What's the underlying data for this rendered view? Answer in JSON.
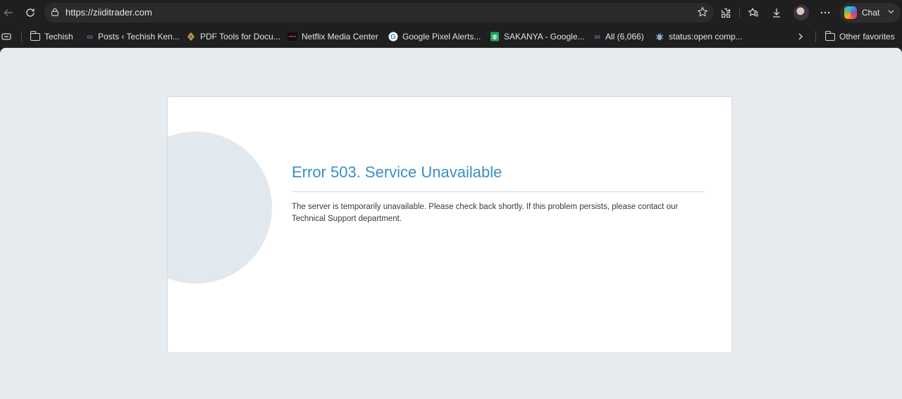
{
  "browser": {
    "url": "https://ziiditrader.com",
    "chat_label": "Chat",
    "icons": [
      "back-icon",
      "reload-icon",
      "lock-icon",
      "star-icon",
      "extensions-icon",
      "favorites-icon",
      "download-icon",
      "more-icon",
      "copilot-icon",
      "chevron-down-icon"
    ]
  },
  "bookmarks": [
    {
      "label": "Techish",
      "icon": "folder-icon"
    },
    {
      "label": "Posts ‹ Techish Ken...",
      "icon": "chain-icon"
    },
    {
      "label": "PDF Tools for Docu...",
      "icon": "pdf-tool-icon"
    },
    {
      "label": "Netflix Media Center",
      "icon": "netflix-icon"
    },
    {
      "label": "Google Pixel Alerts...",
      "icon": "google-icon"
    },
    {
      "label": "SAKANYA - Google...",
      "icon": "sheets-icon"
    },
    {
      "label": "All (6,066)",
      "icon": "chain-icon"
    },
    {
      "label": "status:open comp...",
      "icon": "bug-icon"
    }
  ],
  "other_favorites": "Other favorites",
  "error": {
    "title": "Error 503. Service Unavailable",
    "message": "The server is temporarily unavailable. Please check back shortly. If this problem persists, please contact our Technical Support department."
  },
  "colors": {
    "accent": "#3a8fc6",
    "background": "#e6ebf0",
    "chrome": "#1f1f1f"
  }
}
